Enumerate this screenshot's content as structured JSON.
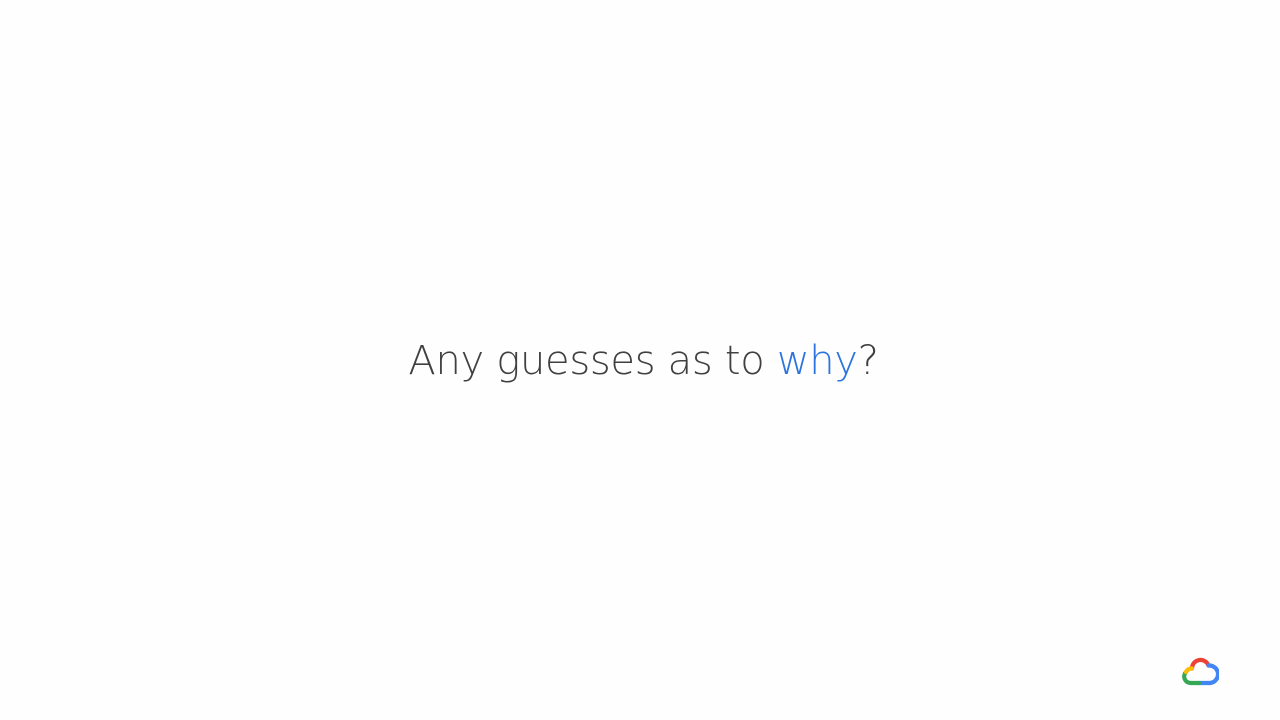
{
  "slide": {
    "text_before": "Any guesses as to ",
    "text_highlight": "why",
    "text_after": "?",
    "highlight_color": "#2c74dd",
    "text_color": "#404040"
  },
  "logo": {
    "icon": "google-cloud-logo-icon",
    "colors": [
      "#ea4335",
      "#fbbc04",
      "#34a853",
      "#4285f4"
    ]
  }
}
